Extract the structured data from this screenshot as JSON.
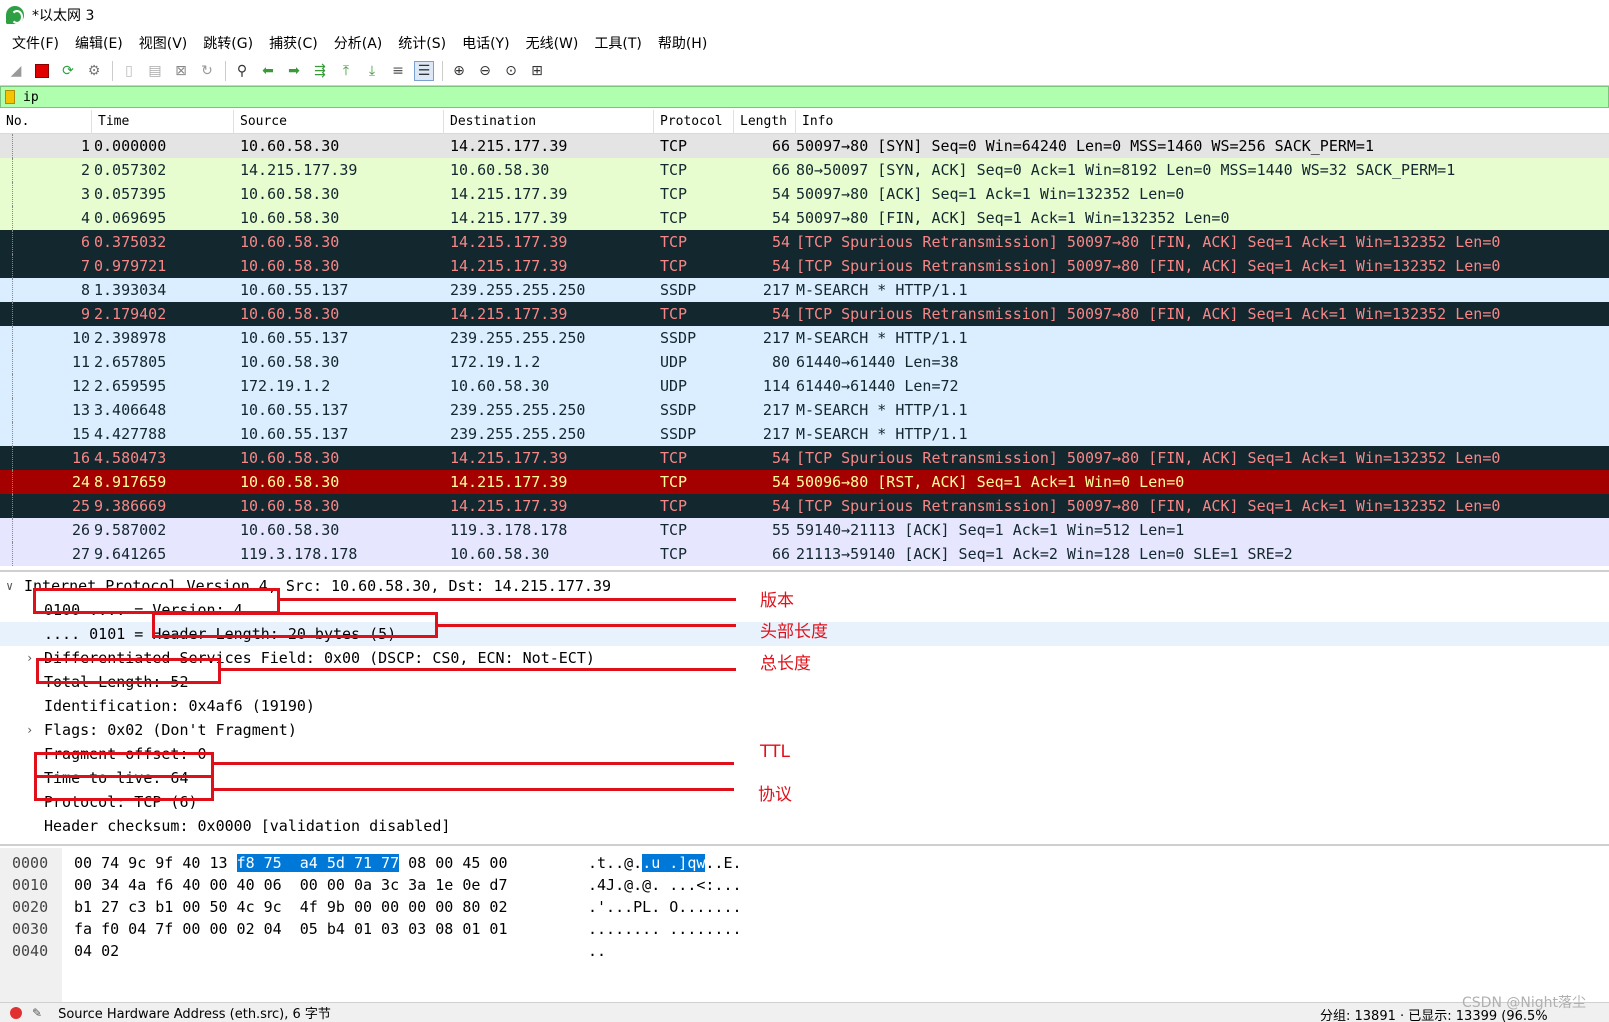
{
  "window": {
    "title": "*以太网 3"
  },
  "menu": [
    "文件(F)",
    "编辑(E)",
    "视图(V)",
    "跳转(G)",
    "捕获(C)",
    "分析(A)",
    "统计(S)",
    "电话(Y)",
    "无线(W)",
    "工具(T)",
    "帮助(H)"
  ],
  "toolbar": [
    "shark-fin-icon",
    "stop-icon",
    "restart-icon",
    "options-gear-icon",
    "open-file-icon",
    "save-file-icon",
    "close-file-icon",
    "reload-icon",
    "find-icon",
    "go-back-icon",
    "go-forward-icon",
    "go-to-packet-icon",
    "first-packet-icon",
    "last-packet-icon",
    "autoscroll-icon",
    "colorize-icon",
    "zoom-in-icon",
    "zoom-out-icon",
    "normal-size-icon",
    "resize-columns-icon"
  ],
  "filter": {
    "value": "ip"
  },
  "packet_list": {
    "columns": [
      "No.",
      "Time",
      "Source",
      "Destination",
      "Protocol",
      "Length",
      "Info"
    ],
    "rows": [
      {
        "no": "1",
        "time": "0.000000",
        "src": "10.60.58.30",
        "dst": "14.215.177.39",
        "proto": "TCP",
        "len": "66",
        "info": "50097→80 [SYN] Seq=0 Win=64240 Len=0 MSS=1460 WS=256 SACK_PERM=1",
        "style": "sel"
      },
      {
        "no": "2",
        "time": "0.057302",
        "src": "14.215.177.39",
        "dst": "10.60.58.30",
        "proto": "TCP",
        "len": "66",
        "info": "80→50097 [SYN, ACK] Seq=0 Ack=1 Win=8192 Len=0 MSS=1440 WS=32 SACK_PERM=1",
        "style": "tcp"
      },
      {
        "no": "3",
        "time": "0.057395",
        "src": "10.60.58.30",
        "dst": "14.215.177.39",
        "proto": "TCP",
        "len": "54",
        "info": "50097→80 [ACK] Seq=1 Ack=1 Win=132352 Len=0",
        "style": "tcp"
      },
      {
        "no": "4",
        "time": "0.069695",
        "src": "10.60.58.30",
        "dst": "14.215.177.39",
        "proto": "TCP",
        "len": "54",
        "info": "50097→80 [FIN, ACK] Seq=1 Ack=1 Win=132352 Len=0",
        "style": "tcp"
      },
      {
        "no": "6",
        "time": "0.375032",
        "src": "10.60.58.30",
        "dst": "14.215.177.39",
        "proto": "TCP",
        "len": "54",
        "info": "[TCP Spurious Retransmission] 50097→80 [FIN, ACK] Seq=1 Ack=1 Win=132352 Len=0",
        "style": "bad"
      },
      {
        "no": "7",
        "time": "0.979721",
        "src": "10.60.58.30",
        "dst": "14.215.177.39",
        "proto": "TCP",
        "len": "54",
        "info": "[TCP Spurious Retransmission] 50097→80 [FIN, ACK] Seq=1 Ack=1 Win=132352 Len=0",
        "style": "bad"
      },
      {
        "no": "8",
        "time": "1.393034",
        "src": "10.60.55.137",
        "dst": "239.255.255.250",
        "proto": "SSDP",
        "len": "217",
        "info": "M-SEARCH * HTTP/1.1",
        "style": "udp"
      },
      {
        "no": "9",
        "time": "2.179402",
        "src": "10.60.58.30",
        "dst": "14.215.177.39",
        "proto": "TCP",
        "len": "54",
        "info": "[TCP Spurious Retransmission] 50097→80 [FIN, ACK] Seq=1 Ack=1 Win=132352 Len=0",
        "style": "bad"
      },
      {
        "no": "10",
        "time": "2.398978",
        "src": "10.60.55.137",
        "dst": "239.255.255.250",
        "proto": "SSDP",
        "len": "217",
        "info": "M-SEARCH * HTTP/1.1",
        "style": "udp"
      },
      {
        "no": "11",
        "time": "2.657805",
        "src": "10.60.58.30",
        "dst": "172.19.1.2",
        "proto": "UDP",
        "len": "80",
        "info": "61440→61440 Len=38",
        "style": "udp"
      },
      {
        "no": "12",
        "time": "2.659595",
        "src": "172.19.1.2",
        "dst": "10.60.58.30",
        "proto": "UDP",
        "len": "114",
        "info": "61440→61440 Len=72",
        "style": "udp"
      },
      {
        "no": "13",
        "time": "3.406648",
        "src": "10.60.55.137",
        "dst": "239.255.255.250",
        "proto": "SSDP",
        "len": "217",
        "info": "M-SEARCH * HTTP/1.1",
        "style": "udp"
      },
      {
        "no": "15",
        "time": "4.427788",
        "src": "10.60.55.137",
        "dst": "239.255.255.250",
        "proto": "SSDP",
        "len": "217",
        "info": "M-SEARCH * HTTP/1.1",
        "style": "udp"
      },
      {
        "no": "16",
        "time": "4.580473",
        "src": "10.60.58.30",
        "dst": "14.215.177.39",
        "proto": "TCP",
        "len": "54",
        "info": "[TCP Spurious Retransmission] 50097→80 [FIN, ACK] Seq=1 Ack=1 Win=132352 Len=0",
        "style": "bad"
      },
      {
        "no": "24",
        "time": "8.917659",
        "src": "10.60.58.30",
        "dst": "14.215.177.39",
        "proto": "TCP",
        "len": "54",
        "info": "50096→80 [RST, ACK] Seq=1 Ack=1 Win=0 Len=0",
        "style": "rst"
      },
      {
        "no": "25",
        "time": "9.386669",
        "src": "10.60.58.30",
        "dst": "14.215.177.39",
        "proto": "TCP",
        "len": "54",
        "info": "[TCP Spurious Retransmission] 50097→80 [FIN, ACK] Seq=1 Ack=1 Win=132352 Len=0",
        "style": "bad"
      },
      {
        "no": "26",
        "time": "9.587002",
        "src": "10.60.58.30",
        "dst": "119.3.178.178",
        "proto": "TCP",
        "len": "55",
        "info": "59140→21113 [ACK] Seq=1 Ack=1 Win=512 Len=1",
        "style": "other"
      },
      {
        "no": "27",
        "time": "9.641265",
        "src": "119.3.178.178",
        "dst": "10.60.58.30",
        "proto": "TCP",
        "len": "66",
        "info": "21113→59140 [ACK] Seq=1 Ack=2 Win=128 Len=0 SLE=1 SRE=2",
        "style": "other"
      }
    ]
  },
  "details": [
    {
      "text": "Internet Protocol Version 4, Src: 10.60.58.30, Dst: 14.215.177.39",
      "level": 0,
      "arrow": "∨"
    },
    {
      "text": "0100 .... = Version: 4",
      "level": 1,
      "arrow": ""
    },
    {
      "text": ".... 0101 = Header Length: 20 bytes (5)",
      "level": 1,
      "arrow": "",
      "highlight": true
    },
    {
      "text": "Differentiated Services Field: 0x00 (DSCP: CS0, ECN: Not-ECT)",
      "level": 1,
      "arrow": "›"
    },
    {
      "text": "Total Length: 52",
      "level": 1,
      "arrow": ""
    },
    {
      "text": "Identification: 0x4af6 (19190)",
      "level": 1,
      "arrow": ""
    },
    {
      "text": "Flags: 0x02 (Don't Fragment)",
      "level": 1,
      "arrow": "›"
    },
    {
      "text": "Fragment offset: 0",
      "level": 1,
      "arrow": ""
    },
    {
      "text": "Time to live: 64",
      "level": 1,
      "arrow": ""
    },
    {
      "text": "Protocol: TCP (6)",
      "level": 1,
      "arrow": ""
    },
    {
      "text": "Header checksum: 0x0000 [validation disabled]",
      "level": 1,
      "arrow": ""
    }
  ],
  "annotations": [
    "版本",
    "头部长度",
    "总长度",
    "TTL",
    "协议"
  ],
  "annotation_color": "#e0101a",
  "bytes": [
    {
      "offset": "0000",
      "hex_pre": "00 74 9c 9f 40 13 ",
      "hex_sel": "f8 75  a4 5d 71 77",
      "hex_post": " 08 00 45 00",
      "asc_pre": ".t..@.",
      "asc_sel": ".u .]qw",
      "asc_post": "..E."
    },
    {
      "offset": "0010",
      "hex_pre": "00 34 4a f6 40 00 40 06  00 00 0a 3c 3a 1e 0e d7",
      "hex_sel": "",
      "hex_post": "",
      "asc_pre": ".4J.@.@. ...<:...",
      "asc_sel": "",
      "asc_post": ""
    },
    {
      "offset": "0020",
      "hex_pre": "b1 27 c3 b1 00 50 4c 9c  4f 9b 00 00 00 00 80 02",
      "hex_sel": "",
      "hex_post": "",
      "asc_pre": ".'...PL. O.......",
      "asc_sel": "",
      "asc_post": ""
    },
    {
      "offset": "0030",
      "hex_pre": "fa f0 04 7f 00 00 02 04  05 b4 01 03 03 08 01 01",
      "hex_sel": "",
      "hex_post": "",
      "asc_pre": "........ ........",
      "asc_sel": "",
      "asc_post": ""
    },
    {
      "offset": "0040",
      "hex_pre": "04 02",
      "hex_sel": "",
      "hex_post": "",
      "asc_pre": "..",
      "asc_sel": "",
      "asc_post": ""
    }
  ],
  "status": {
    "text": "Source Hardware Address (eth.src), 6 字节",
    "right": "分组: 13891 · 已显示: 13399 (96.5%"
  },
  "watermark": "CSDN @Night落尘"
}
